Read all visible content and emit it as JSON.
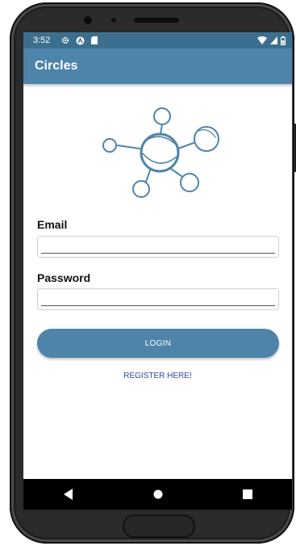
{
  "status_bar": {
    "time": "3:52",
    "icons": [
      "gear-icon",
      "app-icon",
      "sd-card-icon"
    ],
    "right_icons": [
      "wifi-icon",
      "signal-icon",
      "battery-icon"
    ]
  },
  "app_bar": {
    "title": "Circles"
  },
  "form": {
    "email_label": "Email",
    "email_value": "",
    "password_label": "Password",
    "password_value": "",
    "login_label": "LOGIN",
    "register_label": "REGISTER HERE!"
  },
  "nav": {
    "back": "back-icon",
    "home": "home-icon",
    "recents": "recents-icon"
  },
  "colors": {
    "status_bar": "#3c6f8e",
    "app_bar": "#4e84a9",
    "accent": "#4e84a9",
    "link": "#2e47a5"
  }
}
